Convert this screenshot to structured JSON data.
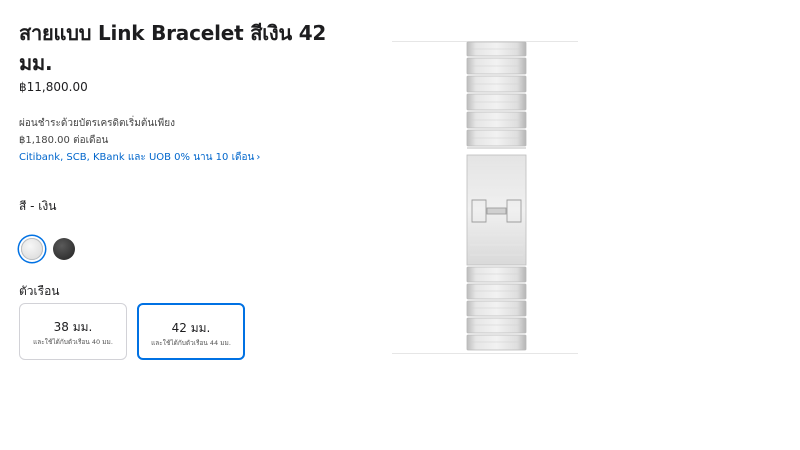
{
  "product": {
    "title": "สายแบบ Link Bracelet สีเงิน 42 มม.",
    "price": "฿11,800.00"
  },
  "installment": {
    "line1": "ผ่อนชำระด้วยบัตรเครดิตเริ่มต้นเพียง",
    "line2": "฿1,180.00 ต่อเดือน",
    "link": "Citibank, SCB, KBank และ UOB 0% นาน 10 เดือน",
    "link_chevron": "›"
  },
  "color": {
    "label": "สี - เงิน",
    "options": [
      {
        "name": "silver",
        "hex": "#e2e2e2",
        "selected": true
      },
      {
        "name": "space-black",
        "hex": "#3a3a3a",
        "selected": false
      }
    ]
  },
  "case": {
    "label": "ตัวเรือน",
    "options": [
      {
        "size": "38 มม.",
        "note": "และใช้ได้กับตัวเรือน 40 มม.",
        "selected": false
      },
      {
        "size": "42 มม.",
        "note": "และใช้ได้กับตัวเรือน 44 มม.",
        "selected": true
      }
    ]
  },
  "colors": {
    "accent": "#0071e3",
    "link": "#0066cc",
    "text": "#1d1d1f",
    "border": "#d2d2d7"
  }
}
